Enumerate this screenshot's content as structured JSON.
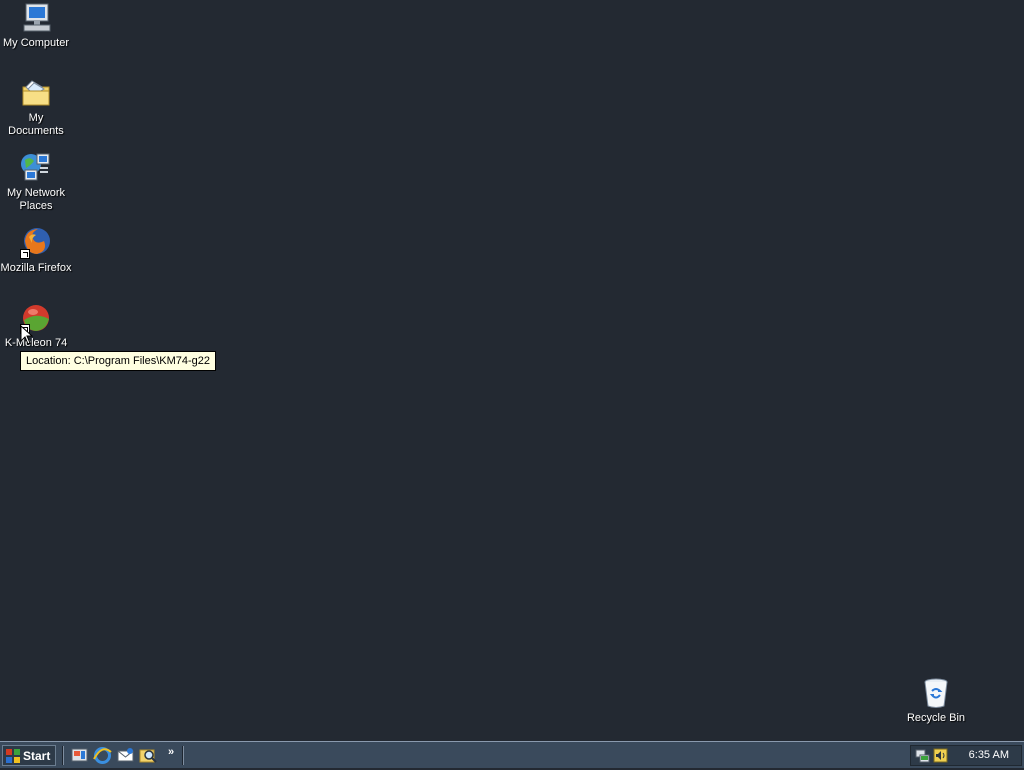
{
  "desktop": {
    "icons": [
      {
        "label": "My Computer",
        "icon": "computer-icon"
      },
      {
        "label": "My Documents",
        "icon": "folder-documents-icon"
      },
      {
        "label": "My Network Places",
        "icon": "network-places-icon"
      },
      {
        "label": "Mozilla Firefox",
        "icon": "firefox-icon"
      },
      {
        "label": "K-Meleon 74",
        "icon": "k-meleon-icon"
      },
      {
        "label": "Recycle Bin",
        "icon": "recycle-bin-icon"
      }
    ],
    "tooltip": "Location: C:\\Program Files\\KM74-g22"
  },
  "taskbar": {
    "start_label": "Start",
    "quick_launch": [
      "desktop-icon",
      "internet-explorer-icon",
      "outlook-express-icon",
      "search-icon"
    ],
    "overflow": "»",
    "tray_icons": [
      "network-icon",
      "volume-icon"
    ],
    "clock": "6:35 AM"
  }
}
